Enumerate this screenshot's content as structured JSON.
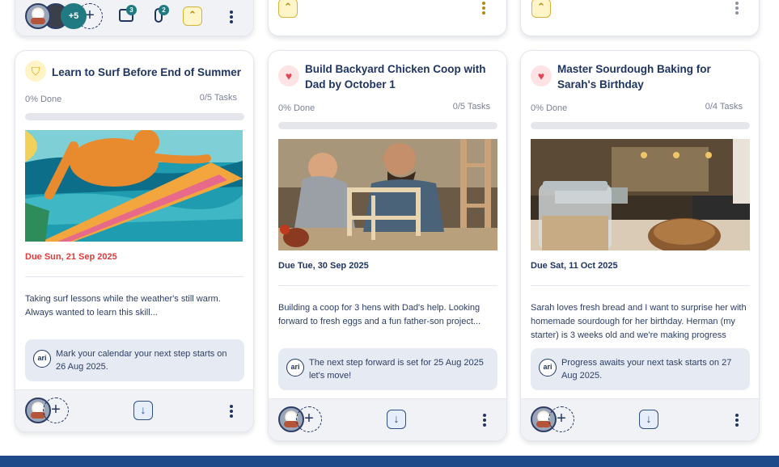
{
  "top_row": {
    "extra_members": "+5",
    "comments_count": "3",
    "attachments_count": "2"
  },
  "cards": [
    {
      "title": "Learn to Surf Before End of Summer",
      "goal_icon": "shield-icon",
      "done": "0% Done",
      "tasks": "0/5 Tasks",
      "progress": 0,
      "due": "Due Sun, 21 Sep 2025",
      "description": "Taking surf lessons while the weather's still warm. Always wanted to learn this skill...",
      "hint": "Mark your calendar your next step starts on 26 Aug 2025.",
      "ari_label": "ari"
    },
    {
      "title": "Build Backyard Chicken Coop with Dad by October 1",
      "goal_icon": "heart-icon",
      "done": "0% Done",
      "tasks": "0/5 Tasks",
      "progress": 0,
      "due": "Due Tue, 30 Sep 2025",
      "description": "Building a coop for 3 hens with Dad's help. Looking forward to fresh eggs and a fun father-son project...",
      "hint": "The next step forward is set for 25 Aug 2025 let's move!",
      "ari_label": "ari"
    },
    {
      "title": "Master Sourdough Baking for Sarah's Birthday",
      "goal_icon": "heart-icon",
      "done": "0% Done",
      "tasks": "0/4 Tasks",
      "progress": 0,
      "due": "Due Sat, 11 Oct 2025",
      "description": "Sarah loves fresh bread and I want to surprise her with homemade sourdough for her birthday. Herman (my starter) is 3 weeks old and we're making progress",
      "hint": "Progress awaits your next task starts on 27 Aug 2025.",
      "ari_label": "ari"
    }
  ],
  "colors": {
    "navy": "#1f3562",
    "due_overdue": "#e03a3a",
    "accent_gold": "#d9b23b",
    "footer_band": "#1e4a8a"
  }
}
